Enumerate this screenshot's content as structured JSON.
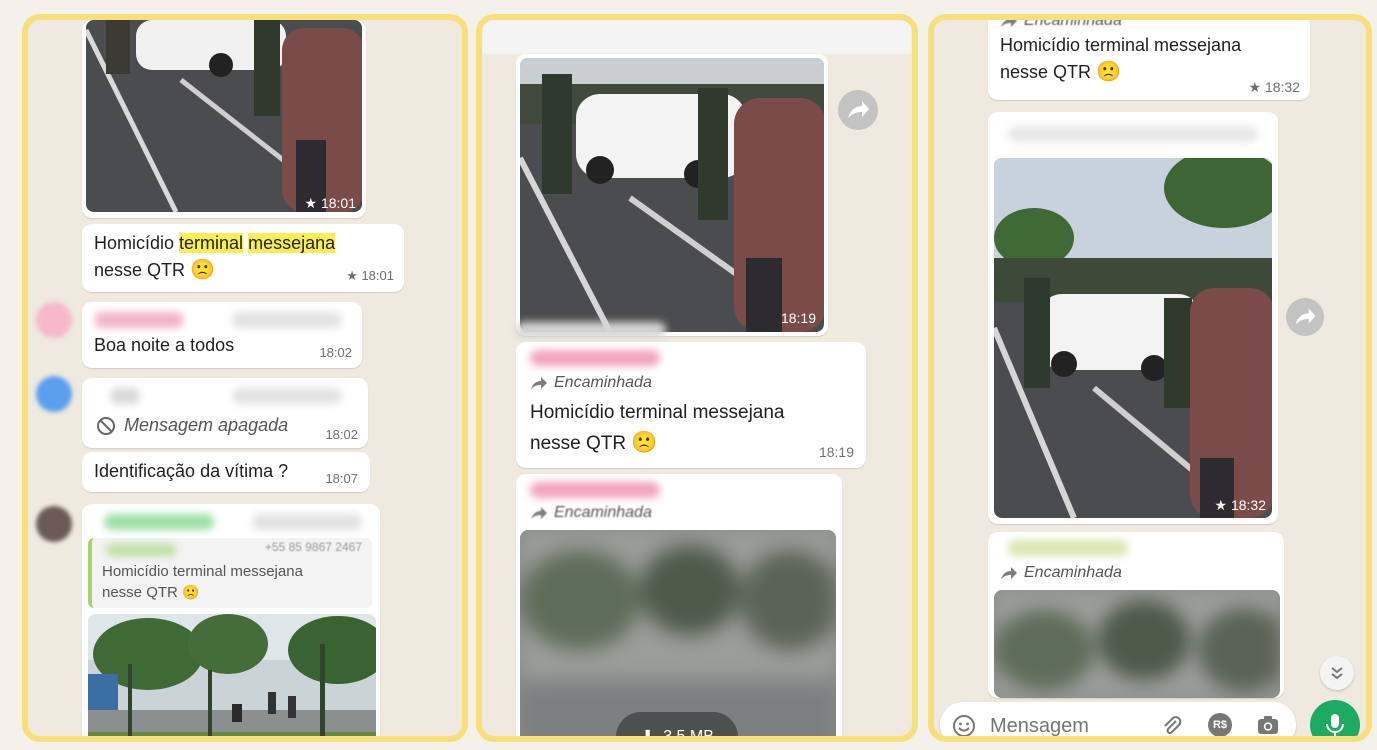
{
  "panel1": {
    "photo_top": {
      "time": "★ 18:01"
    },
    "msg_homicidio": {
      "text_a": "Homicídio ",
      "text_hl1": "terminal",
      "text_b": " ",
      "text_hl2": "messejana",
      "text_c": "nesse QTR",
      "emoji": "🙁",
      "time": "★ 18:01"
    },
    "msg_boa_noite": {
      "text": "Boa noite a todos",
      "time": "18:02"
    },
    "msg_apagada": {
      "text": "Mensagem apagada",
      "time": "18:02"
    },
    "msg_identificacao": {
      "text": "Identificação da vítima ?",
      "time": "18:07"
    },
    "quoted": {
      "sender": "+55 85 9867 2467",
      "text_a": "Homicídio terminal messejana",
      "text_b": "nesse QTR",
      "emoji": "🙁"
    }
  },
  "panel2": {
    "photo_top": {
      "time": "18:19"
    },
    "msg_forward": {
      "forward_label": "Encaminhada",
      "text_a": "Homicídio terminal messejana",
      "text_b": "nesse QTR",
      "emoji": "🙁",
      "time": "18:19"
    },
    "msg_forward2": {
      "forward_label": "Encaminhada"
    },
    "download": {
      "size": "3,5 MB"
    }
  },
  "panel3": {
    "msg_top": {
      "forward_label": "Encaminhada",
      "text_a": "Homicídio terminal messejana",
      "text_b": "nesse QTR",
      "emoji": "🙁",
      "time": "★ 18:32"
    },
    "photo": {
      "time": "★ 18:32"
    },
    "msg_forward2": {
      "forward_label": "Encaminhada"
    },
    "composer": {
      "placeholder": "Mensagem",
      "payment_label": "R$"
    }
  },
  "colors": {
    "frame": "#f8df7b",
    "chat_bg": "#efe9df",
    "whatsapp_green": "#1daa61",
    "highlight": "#f7ee55"
  }
}
